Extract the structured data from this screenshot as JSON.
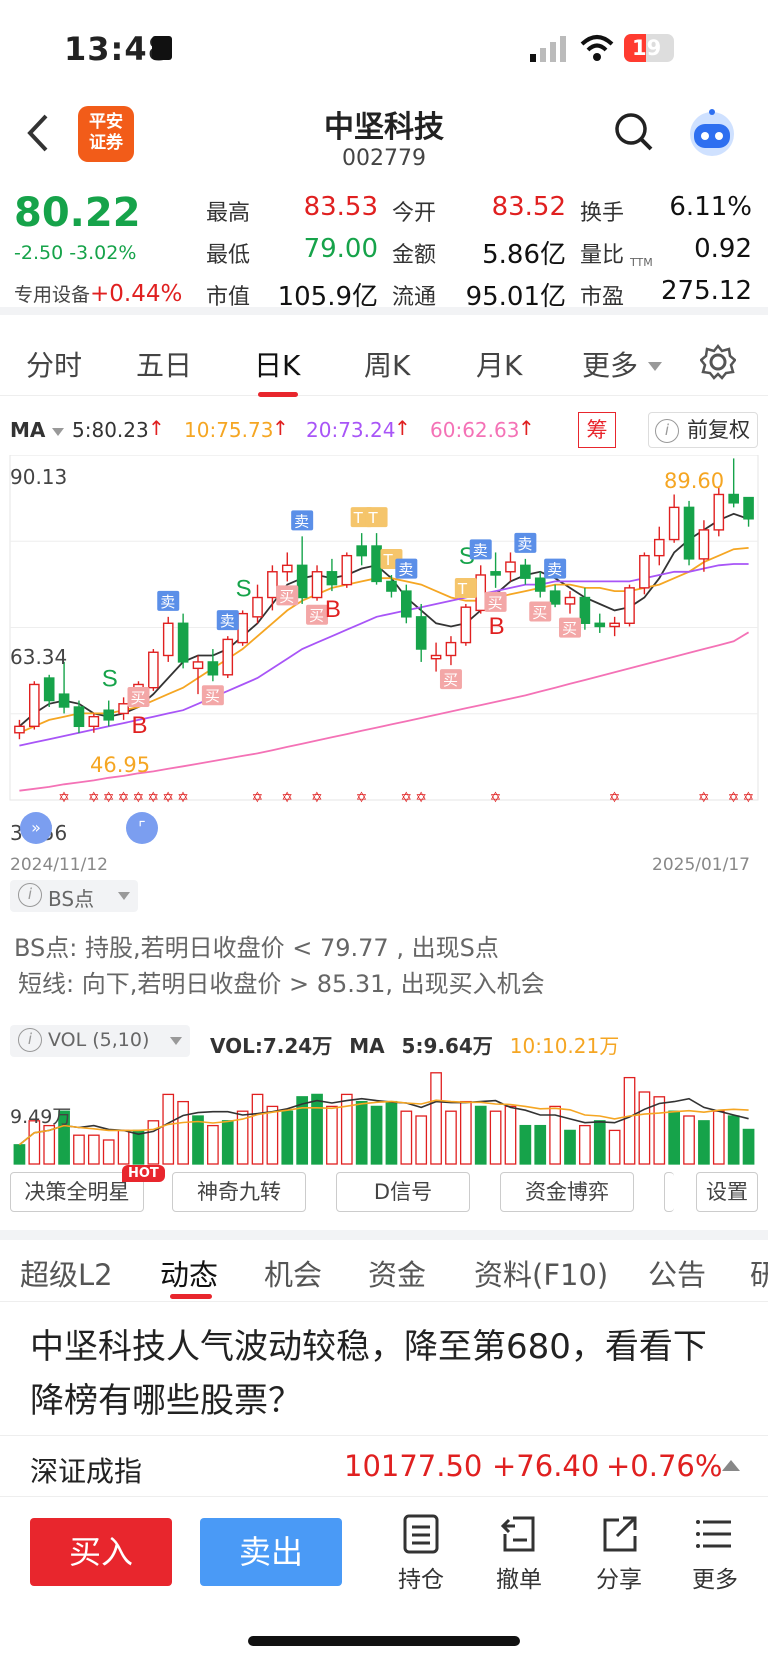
{
  "status": {
    "time": "13:48",
    "battery": "19"
  },
  "header": {
    "title": "中坚科技",
    "code": "002779",
    "logo_line1": "平安",
    "logo_line2": "证券"
  },
  "quote": {
    "price": "80.22",
    "change": "-2.50 -3.02%",
    "sector_label": "专用设备",
    "sector_change": "+0.44%",
    "fields": [
      {
        "label": "最高",
        "value": "83.53",
        "tone": "red"
      },
      {
        "label": "今开",
        "value": "83.52",
        "tone": "red"
      },
      {
        "label": "换手",
        "value": "6.11%",
        "tone": "blk"
      },
      {
        "label": "最低",
        "value": "79.00",
        "tone": "green"
      },
      {
        "label": "金额",
        "value": "5.86亿",
        "tone": "blk"
      },
      {
        "label": "量比",
        "value": "0.92",
        "tone": "blk"
      },
      {
        "label": "市值",
        "value": "105.9亿",
        "tone": "blk"
      },
      {
        "label": "流通",
        "value": "95.01亿",
        "tone": "blk"
      },
      {
        "label": "市盈",
        "value": "275.12",
        "tone": "blk"
      }
    ],
    "pe_sup": "TTM"
  },
  "chart_tabs": {
    "items": [
      "分时",
      "五日",
      "日K",
      "周K",
      "月K",
      "更多"
    ],
    "active": "日K"
  },
  "ma": {
    "label": "MA",
    "ma5": "5:80.23",
    "ma10": "10:75.73",
    "ma20": "20:73.24",
    "ma60": "60:62.63",
    "chip_label": "筹",
    "adjust_label": "前复权",
    "colors": {
      "ma5": "#333333",
      "ma10": "#f5a623",
      "ma20": "#a855f7",
      "ma60": "#f472b6"
    }
  },
  "kline": {
    "y_top": "90.13",
    "y_mid": "63.34",
    "y_bottom": "36.56",
    "date_start": "2024/11/12",
    "date_end": "2025/01/17",
    "high_label": "89.60",
    "low_label": "46.95"
  },
  "chart_data": {
    "type": "candlestick",
    "ylim": [
      36.56,
      90.13
    ],
    "candles": [
      {
        "o": 47.0,
        "h": 49.0,
        "l": 46.0,
        "c": 48.0,
        "u": 1
      },
      {
        "o": 48.0,
        "h": 55.0,
        "l": 47.5,
        "c": 54.5,
        "u": 1
      },
      {
        "o": 52.0,
        "h": 56.0,
        "l": 51.0,
        "c": 55.5,
        "u": 0
      },
      {
        "o": 53.0,
        "h": 58.0,
        "l": 50.0,
        "c": 51.0,
        "u": 0
      },
      {
        "o": 51.0,
        "h": 52.0,
        "l": 46.95,
        "c": 48.0,
        "u": 0
      },
      {
        "o": 48.0,
        "h": 50.0,
        "l": 47.0,
        "c": 49.5,
        "u": 1
      },
      {
        "o": 49.0,
        "h": 52.0,
        "l": 48.0,
        "c": 50.5,
        "u": 0
      },
      {
        "o": 50.0,
        "h": 52.5,
        "l": 49.0,
        "c": 51.5,
        "u": 1
      },
      {
        "o": 51.5,
        "h": 55.0,
        "l": 51.0,
        "c": 54.5,
        "u": 1
      },
      {
        "o": 54.0,
        "h": 60.0,
        "l": 53.5,
        "c": 59.5,
        "u": 1
      },
      {
        "o": 59.0,
        "h": 65.0,
        "l": 58.0,
        "c": 64.0,
        "u": 1
      },
      {
        "o": 64.0,
        "h": 65.5,
        "l": 57.0,
        "c": 58.0,
        "u": 0
      },
      {
        "o": 57.0,
        "h": 59.0,
        "l": 53.0,
        "c": 58.0,
        "u": 1
      },
      {
        "o": 58.0,
        "h": 60.0,
        "l": 55.0,
        "c": 56.0,
        "u": 0
      },
      {
        "o": 56.0,
        "h": 62.0,
        "l": 55.5,
        "c": 61.5,
        "u": 1
      },
      {
        "o": 61.0,
        "h": 66.0,
        "l": 60.5,
        "c": 65.5,
        "u": 1
      },
      {
        "o": 65.0,
        "h": 70.0,
        "l": 64.0,
        "c": 68.0,
        "u": 1
      },
      {
        "o": 68.0,
        "h": 73.0,
        "l": 66.0,
        "c": 72.0,
        "u": 1
      },
      {
        "o": 72.0,
        "h": 75.0,
        "l": 70.5,
        "c": 73.0,
        "u": 1
      },
      {
        "o": 73.0,
        "h": 77.5,
        "l": 67.0,
        "c": 68.0,
        "u": 0
      },
      {
        "o": 68.0,
        "h": 73.0,
        "l": 67.5,
        "c": 72.0,
        "u": 1
      },
      {
        "o": 72.0,
        "h": 74.0,
        "l": 69.0,
        "c": 70.0,
        "u": 0
      },
      {
        "o": 70.0,
        "h": 75.0,
        "l": 69.5,
        "c": 74.5,
        "u": 1
      },
      {
        "o": 74.5,
        "h": 78.0,
        "l": 73.0,
        "c": 76.0,
        "u": 0
      },
      {
        "o": 76.0,
        "h": 78.0,
        "l": 70.0,
        "c": 70.5,
        "u": 0
      },
      {
        "o": 70.5,
        "h": 71.5,
        "l": 68.0,
        "c": 69.0,
        "u": 0
      },
      {
        "o": 69.0,
        "h": 70.0,
        "l": 64.0,
        "c": 65.0,
        "u": 0
      },
      {
        "o": 65.0,
        "h": 67.0,
        "l": 58.0,
        "c": 60.0,
        "u": 0
      },
      {
        "o": 59.0,
        "h": 61.0,
        "l": 56.5,
        "c": 58.5,
        "u": 1
      },
      {
        "o": 59.0,
        "h": 62.0,
        "l": 57.5,
        "c": 61.0,
        "u": 1
      },
      {
        "o": 61.0,
        "h": 67.0,
        "l": 60.5,
        "c": 66.5,
        "u": 1
      },
      {
        "o": 66.0,
        "h": 73.0,
        "l": 65.5,
        "c": 71.5,
        "u": 1
      },
      {
        "o": 71.5,
        "h": 75.0,
        "l": 69.5,
        "c": 72.0,
        "u": 0
      },
      {
        "o": 72.0,
        "h": 75.0,
        "l": 70.5,
        "c": 73.5,
        "u": 1
      },
      {
        "o": 73.0,
        "h": 74.0,
        "l": 70.0,
        "c": 71.0,
        "u": 0
      },
      {
        "o": 71.0,
        "h": 72.0,
        "l": 68.0,
        "c": 69.0,
        "u": 0
      },
      {
        "o": 69.0,
        "h": 70.0,
        "l": 66.5,
        "c": 67.0,
        "u": 0
      },
      {
        "o": 67.0,
        "h": 69.0,
        "l": 65.5,
        "c": 68.0,
        "u": 1
      },
      {
        "o": 68.0,
        "h": 69.5,
        "l": 63.0,
        "c": 64.0,
        "u": 0
      },
      {
        "o": 64.0,
        "h": 65.5,
        "l": 62.5,
        "c": 63.5,
        "u": 0
      },
      {
        "o": 63.5,
        "h": 65.0,
        "l": 62.0,
        "c": 64.0,
        "u": 1
      },
      {
        "o": 64.0,
        "h": 70.0,
        "l": 63.5,
        "c": 69.5,
        "u": 1
      },
      {
        "o": 69.5,
        "h": 75.0,
        "l": 68.5,
        "c": 74.5,
        "u": 1
      },
      {
        "o": 74.5,
        "h": 79.0,
        "l": 73.0,
        "c": 77.0,
        "u": 1
      },
      {
        "o": 77.0,
        "h": 84.0,
        "l": 76.5,
        "c": 82.0,
        "u": 1
      },
      {
        "o": 82.0,
        "h": 83.0,
        "l": 73.0,
        "c": 74.0,
        "u": 0
      },
      {
        "o": 74.0,
        "h": 80.0,
        "l": 72.0,
        "c": 78.5,
        "u": 1
      },
      {
        "o": 78.5,
        "h": 85.0,
        "l": 77.5,
        "c": 84.0,
        "u": 1
      },
      {
        "o": 84.0,
        "h": 89.6,
        "l": 82.0,
        "c": 82.7,
        "u": 0
      },
      {
        "o": 83.52,
        "h": 83.53,
        "l": 79.0,
        "c": 80.22,
        "u": 0
      }
    ],
    "ma_series": [
      {
        "name": "5",
        "color": "#333333",
        "values": [
          48,
          50,
          51.5,
          52,
          51.5,
          50,
          49.5,
          50,
          51,
          53,
          55.5,
          58,
          59,
          59,
          60,
          62,
          64,
          67,
          70,
          71,
          71.5,
          71,
          71.5,
          72.5,
          73,
          71,
          68,
          66,
          64,
          63.5,
          64,
          66,
          68.5,
          70.5,
          71.5,
          72,
          71,
          69.5,
          68,
          67,
          66,
          66.5,
          68,
          71,
          75,
          77,
          78.5,
          80,
          81,
          80.2
        ]
      },
      {
        "name": "10",
        "color": "#f5a623",
        "values": [
          47,
          48,
          49,
          49.5,
          50,
          50,
          50,
          50.5,
          51,
          52,
          53,
          54,
          55.5,
          57,
          58.5,
          60,
          62,
          64,
          66,
          67.5,
          68.5,
          69.5,
          70,
          70.5,
          71,
          71,
          70.5,
          70,
          69,
          68,
          67.5,
          67.5,
          68,
          68.5,
          69,
          69.5,
          70,
          70,
          69.5,
          69.5,
          69,
          69,
          69.5,
          70,
          71,
          72,
          73.5,
          74.5,
          75.5,
          75.7
        ]
      },
      {
        "name": "20",
        "color": "#a855f7",
        "values": [
          45,
          45.5,
          46,
          46.5,
          47,
          47.5,
          48,
          48.5,
          49,
          49.5,
          50,
          50.5,
          51.5,
          52.5,
          53.5,
          54.5,
          55.5,
          57,
          58.5,
          60,
          61,
          62,
          63,
          64,
          65,
          65.5,
          66,
          66.5,
          67,
          67.5,
          68,
          68.5,
          69,
          69.5,
          70,
          70,
          70.5,
          70.5,
          70.5,
          70.5,
          70.5,
          70.5,
          71,
          71.5,
          72,
          72,
          72.5,
          73,
          73.2,
          73.2
        ]
      },
      {
        "name": "60",
        "color": "#f472b6",
        "values": [
          38,
          38.3,
          38.6,
          39,
          39.3,
          39.6,
          40,
          40.3,
          40.7,
          41,
          41.4,
          41.8,
          42.2,
          42.6,
          43,
          43.4,
          43.8,
          44.3,
          44.8,
          45.3,
          45.8,
          46.3,
          46.8,
          47.3,
          47.8,
          48.3,
          48.8,
          49.3,
          49.8,
          50.3,
          50.8,
          51.3,
          51.8,
          52.3,
          52.8,
          53.4,
          54,
          54.6,
          55.2,
          55.8,
          56.4,
          57,
          57.6,
          58.2,
          58.8,
          59.4,
          60,
          60.6,
          61.2,
          62.6
        ]
      }
    ],
    "signals": [
      {
        "i": 6,
        "text": "S",
        "kind": "S"
      },
      {
        "i": 8,
        "text": "B",
        "kind": "B"
      },
      {
        "i": 8,
        "text": "买",
        "kind": "buy"
      },
      {
        "i": 10,
        "text": "卖",
        "kind": "sell"
      },
      {
        "i": 13,
        "text": "买",
        "kind": "buy"
      },
      {
        "i": 14,
        "text": "卖",
        "kind": "sell"
      },
      {
        "i": 15,
        "text": "S",
        "kind": "S"
      },
      {
        "i": 18,
        "text": "买",
        "kind": "buy"
      },
      {
        "i": 19,
        "text": "卖",
        "kind": "sell"
      },
      {
        "i": 20,
        "text": "买",
        "kind": "buy"
      },
      {
        "i": 21,
        "text": "B",
        "kind": "B"
      },
      {
        "i": 23,
        "text": "T",
        "kind": "T"
      },
      {
        "i": 24,
        "text": "T",
        "kind": "T"
      },
      {
        "i": 25,
        "text": "T",
        "kind": "T"
      },
      {
        "i": 26,
        "text": "卖",
        "kind": "sell"
      },
      {
        "i": 29,
        "text": "买",
        "kind": "buy"
      },
      {
        "i": 30,
        "text": "T",
        "kind": "T"
      },
      {
        "i": 30,
        "text": "S",
        "kind": "S"
      },
      {
        "i": 31,
        "text": "卖",
        "kind": "sell"
      },
      {
        "i": 32,
        "text": "买",
        "kind": "buy"
      },
      {
        "i": 32,
        "text": "B",
        "kind": "B"
      },
      {
        "i": 34,
        "text": "卖",
        "kind": "sell"
      },
      {
        "i": 35,
        "text": "买",
        "kind": "buy"
      },
      {
        "i": 36,
        "text": "卖",
        "kind": "sell"
      },
      {
        "i": 37,
        "text": "买",
        "kind": "buy"
      }
    ]
  },
  "bs": {
    "label": "BS点",
    "line1": "BS点: 持股,若明日收盘价 < 79.77 , 出现S点",
    "line2": "短线: 向下,若明日收盘价 > 85.31, 出现买入机会"
  },
  "vol": {
    "label": "VOL (5,10)",
    "vol_text": "VOL:7.24万",
    "ma_label": "MA",
    "ma5_text": "5:9.64万",
    "ma10_text": "10:10.21万",
    "y_label": "9.49万",
    "bars": [
      {
        "v": 4,
        "u": 0
      },
      {
        "v": 9,
        "u": 1
      },
      {
        "v": 8,
        "u": 1
      },
      {
        "v": 11,
        "u": 0
      },
      {
        "v": 6,
        "u": 1
      },
      {
        "v": 6,
        "u": 1
      },
      {
        "v": 5,
        "u": 1
      },
      {
        "v": 7,
        "u": 1
      },
      {
        "v": 7,
        "u": 0
      },
      {
        "v": 9,
        "u": 1
      },
      {
        "v": 14.5,
        "u": 1
      },
      {
        "v": 13,
        "u": 1
      },
      {
        "v": 10,
        "u": 0
      },
      {
        "v": 8,
        "u": 1
      },
      {
        "v": 9,
        "u": 0
      },
      {
        "v": 11,
        "u": 1
      },
      {
        "v": 14.5,
        "u": 1
      },
      {
        "v": 12,
        "u": 1
      },
      {
        "v": 11,
        "u": 0
      },
      {
        "v": 14,
        "u": 0
      },
      {
        "v": 14.5,
        "u": 0
      },
      {
        "v": 12,
        "u": 1
      },
      {
        "v": 14.5,
        "u": 1
      },
      {
        "v": 13,
        "u": 0
      },
      {
        "v": 12,
        "u": 0
      },
      {
        "v": 13,
        "u": 0
      },
      {
        "v": 11,
        "u": 1
      },
      {
        "v": 10,
        "u": 1
      },
      {
        "v": 19,
        "u": 1
      },
      {
        "v": 11,
        "u": 1
      },
      {
        "v": 13,
        "u": 1
      },
      {
        "v": 12,
        "u": 0
      },
      {
        "v": 11,
        "u": 1
      },
      {
        "v": 12,
        "u": 1
      },
      {
        "v": 8,
        "u": 0
      },
      {
        "v": 8,
        "u": 0
      },
      {
        "v": 12,
        "u": 1
      },
      {
        "v": 7,
        "u": 0
      },
      {
        "v": 8,
        "u": 1
      },
      {
        "v": 9,
        "u": 0
      },
      {
        "v": 7,
        "u": 1
      },
      {
        "v": 18,
        "u": 1
      },
      {
        "v": 15,
        "u": 1
      },
      {
        "v": 14,
        "u": 1
      },
      {
        "v": 11,
        "u": 0
      },
      {
        "v": 10,
        "u": 1
      },
      {
        "v": 9,
        "u": 0
      },
      {
        "v": 11,
        "u": 1
      },
      {
        "v": 10,
        "u": 0
      },
      {
        "v": 7.2,
        "u": 0
      }
    ]
  },
  "tools": {
    "items": [
      "决策全明星",
      "神奇九转",
      "D信号",
      "资金博弈"
    ],
    "hot": "HOT",
    "settings": "设置"
  },
  "content_tabs": {
    "items": [
      "超级L2",
      "动态",
      "机会",
      "资金",
      "资料(F10)",
      "公告",
      "研"
    ],
    "active": "动态"
  },
  "news": {
    "headline": "中坚科技人气波动较稳，降至第680，看看下降榜有哪些股票？"
  },
  "index": {
    "name": "深证成指",
    "value": "10177.50",
    "change": "+76.40",
    "percent": "+0.76%"
  },
  "bottom": {
    "buy": "买入",
    "sell": "卖出",
    "hold": "持仓",
    "cancel": "撤单",
    "share": "分享",
    "more": "更多"
  }
}
